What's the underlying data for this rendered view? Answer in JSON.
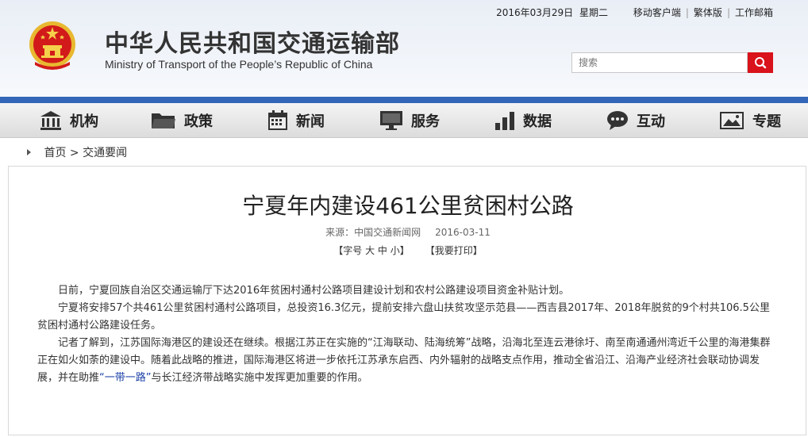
{
  "topbar": {
    "date": "2016年03月29日",
    "weekday": "星期二",
    "links": [
      "移动客户端",
      "繁体版",
      "工作邮箱"
    ]
  },
  "header": {
    "title_cn": "中华人民共和国交通运输部",
    "title_en": "Ministry of Transport of the People’s Republic of China",
    "emblem_icon": "national-emblem-icon"
  },
  "search": {
    "placeholder": "搜索"
  },
  "colors": {
    "accent_blue": "#3366b8",
    "search_red": "#d9121b",
    "link_blue": "#1a3fa6"
  },
  "nav": {
    "items": [
      {
        "label": "机构",
        "icon": "building-icon"
      },
      {
        "label": "政策",
        "icon": "folder-icon"
      },
      {
        "label": "新闻",
        "icon": "calendar-icon"
      },
      {
        "label": "服务",
        "icon": "monitor-icon"
      },
      {
        "label": "数据",
        "icon": "bar-chart-icon"
      },
      {
        "label": "互动",
        "icon": "chat-bubble-icon"
      },
      {
        "label": "专题",
        "icon": "picture-icon"
      }
    ]
  },
  "breadcrumb": {
    "home": "首页",
    "separator": ">",
    "section": "交通要闻"
  },
  "article": {
    "title": "宁夏年内建设461公里贫困村公路",
    "source": "来源：中国交通新闻网",
    "date": "2016-03-11",
    "font_size_tool": "【字号 大 中 小】",
    "print_tool": "【我要打印】",
    "p1": "日前，宁夏回族自治区交通运输厅下达2016年贫困村通村公路项目建设计划和农村公路建设项目资金补贴计划。",
    "p2": "宁夏将安排57个共461公里贫困村通村公路项目，总投资16.3亿元，提前安排六盘山扶贫攻坚示范县——西吉县2017年、2018年脱贫的9个村共106.5公里贫困村通村公路建设任务。",
    "p3_before": "记者了解到，江苏国际海港区的建设还在继续。根据江苏正在实施的“江海联动、陆海统筹”战略，沿海北至连云港徐圩、南至南通通州湾近千公里的海港集群正在如火如荼的建设中。随着此战略的推进，国际海港区将进一步依托江苏承东启西、内外辐射的战略支点作用，推动全省沿江、沿海产业经济社会联动协调发展，并在助推",
    "p3_link": "“一带一路”",
    "p3_after": "与长江经济带战略实施中发挥更加重要的作用。"
  }
}
